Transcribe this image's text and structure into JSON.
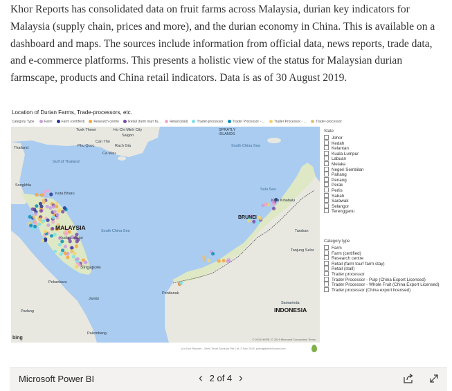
{
  "intro": "Khor Reports has consolidated data on fruit farms across Malaysia, durian key indicators for Malaysia (supply chain, prices and more), and the durian economy in China. This is available on a dashboard and maps. The sources include information from official data, news reports, trade data, and e-commerce platforms. This presents a holistic view of the status for Malaysian durian farmscape, products and China retail indicators. Data is as of 30 August 2019.",
  "report": {
    "map_title": "Location of Durian Farms, Trade-processors, etc.",
    "legend_title": "Category Type",
    "legend_items": [
      {
        "label": "Farm",
        "color": "#c8a0e0"
      },
      {
        "label": "Farm (certified)",
        "color": "#283593"
      },
      {
        "label": "Research centre",
        "color": "#f4a640"
      },
      {
        "label": "Retail (farm tour/ fa...",
        "color": "#7a4aa8"
      },
      {
        "label": "Retail (stall)",
        "color": "#f0a8d0"
      },
      {
        "label": "Trader-processor",
        "color": "#7fe0e8"
      },
      {
        "label": "Trader Processor - ...",
        "color": "#0a8fb8"
      },
      {
        "label": "Trader Processor - ...",
        "color": "#f6d36b"
      },
      {
        "label": "Trader-processor",
        "color": "#e8c07a"
      }
    ],
    "map_labels": {
      "ho_chi_minh": "Ho Chi Minh City",
      "saigon": "Saigon",
      "can_tho": "Can Tho",
      "spratly": "SPRATLY ISLANDS",
      "tuk_thmei": "Tuek Thmei",
      "phu_quoc": "Phu Quoc",
      "rach_gia": "Rach Gia",
      "ca_mau": "Ca Mau",
      "thailand": "Thailand",
      "gulf": "Gulf of Thailand",
      "south_china_sea_n": "South China Sea",
      "south_china_sea_s": "South China Sea",
      "songkhla": "Songkhla",
      "kota_bharu": "Kota Bharu",
      "malaysia": "MALAYSIA",
      "kuala_lumpur": "Kuala Lumpur",
      "singapore": "Singapore",
      "brunei": "BRUNEI",
      "kota_kinabalu": "Kota Kinabalu",
      "sulu_sea": "Sulu Sea",
      "tarakan": "Tarakan",
      "tanjung_selor": "Tanjung Selor",
      "samarinda": "Samarinda",
      "indonesia": "INDONESIA",
      "pontianak": "Pontianak",
      "padang": "Padang",
      "palembang": "Palembang",
      "pekanbaru": "Pekanbaru",
      "jambi": "Jambi"
    },
    "bing": "bing",
    "map_copyright": "© 2019 HERE, © 2019 Microsoft Corporation Terms",
    "footer_note": "(c) Khor Reports - Seed Team Advisory Pte Ltd, 3 Sep 2019. pdeng@seed-team.com",
    "state_slicer": {
      "title": "State",
      "options": [
        "Johor",
        "Kedah",
        "Kelantan",
        "Kuala Lumpur",
        "Labuan",
        "Melaka",
        "Negeri Sembilan",
        "Pahang",
        "Penang",
        "Perak",
        "Perlis",
        "Sabah",
        "Sarawak",
        "Selangor",
        "Terengganu"
      ]
    },
    "category_slicer": {
      "title": "Category type",
      "options": [
        "Farm",
        "Farm (certified)",
        "Research centre",
        "Retail (farm tour/ farm stay)",
        "Retail (stall)",
        "Trader processor",
        "Trader Processor - Pulp (China Export Licensed)",
        "Trader Processor - Whole Fruit (China Export Licensed)",
        "Trader processor (China export licensed)"
      ]
    }
  },
  "footer": {
    "app_label": "Microsoft Power BI",
    "prev": "‹",
    "page_indicator": "2 of 4",
    "next": "›",
    "share_icon": "share-icon",
    "fullscreen_icon": "fullscreen-icon"
  }
}
